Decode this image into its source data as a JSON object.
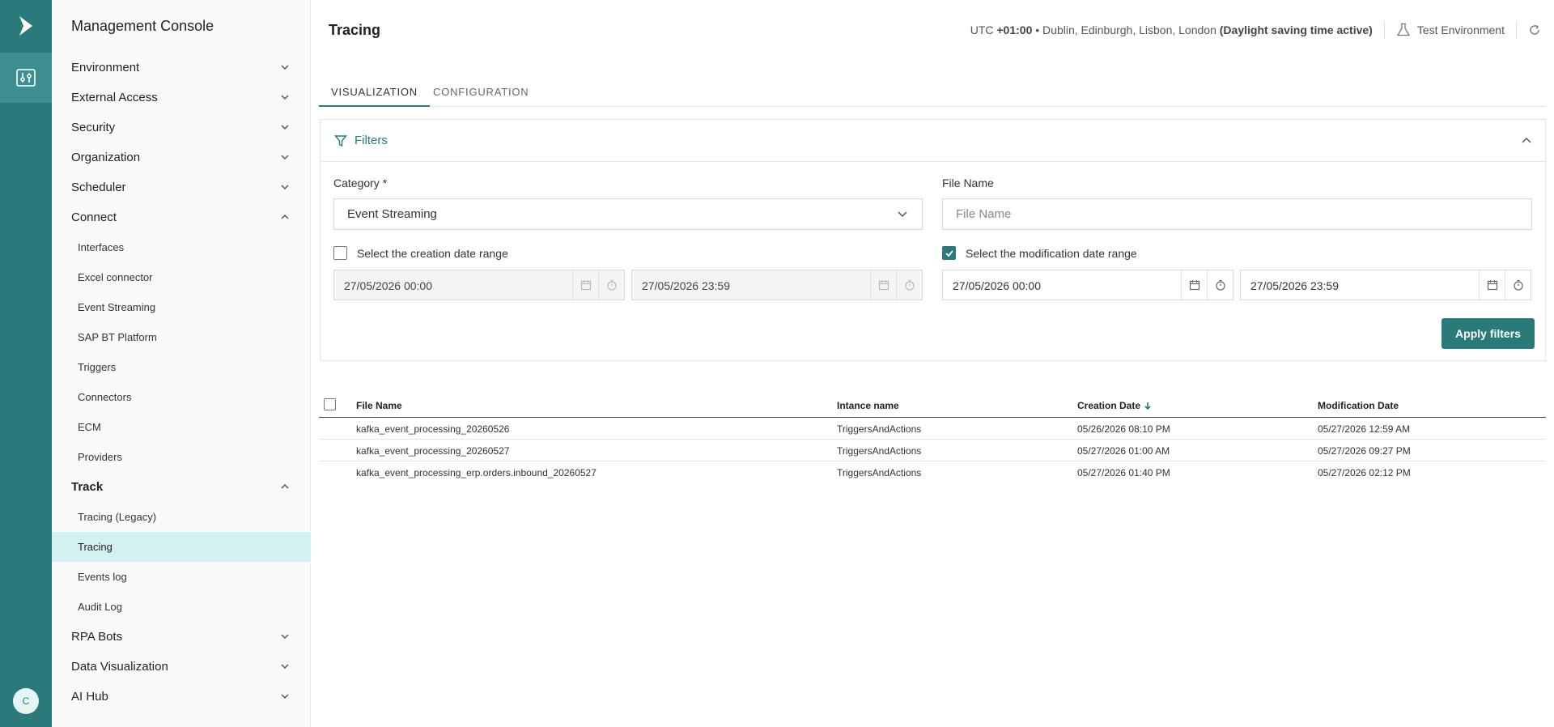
{
  "colors": {
    "primary": "#2a7a7a",
    "active_item_bg": "#d4f1f1"
  },
  "rail": {
    "logo_icon": "play-arrow-icon",
    "active_icon": "sliders-icon",
    "avatar_initial": "C"
  },
  "sidebar": {
    "title": "Management Console",
    "items": [
      {
        "label": "Environment",
        "expanded": false
      },
      {
        "label": "External Access",
        "expanded": false
      },
      {
        "label": "Security",
        "expanded": false
      },
      {
        "label": "Organization",
        "expanded": false
      },
      {
        "label": "Scheduler",
        "expanded": false
      },
      {
        "label": "Connect",
        "expanded": true,
        "children": [
          "Interfaces",
          "Excel connector",
          "Event Streaming",
          "SAP BT Platform",
          "Triggers",
          "Connectors",
          "ECM",
          "Providers"
        ]
      },
      {
        "label": "Track",
        "expanded": true,
        "children": [
          "Tracing (Legacy)",
          "Tracing",
          "Events log",
          "Audit Log"
        ],
        "active_child": "Tracing"
      },
      {
        "label": "RPA Bots",
        "expanded": false
      },
      {
        "label": "Data Visualization",
        "expanded": false
      },
      {
        "label": "AI Hub",
        "expanded": false
      }
    ]
  },
  "header": {
    "title": "Tracing",
    "timezone_prefix": "UTC",
    "timezone_offset": "+01:00",
    "timezone_cities": "• Dublin, Edinburgh, Lisbon, London",
    "timezone_dst": "(Daylight saving time active)",
    "environment": "Test Environment"
  },
  "tabs": [
    {
      "label": "VISUALIZATION",
      "active": true
    },
    {
      "label": "CONFIGURATION",
      "active": false
    }
  ],
  "filters": {
    "title": "Filters",
    "category_label": "Category *",
    "category_value": "Event Streaming",
    "file_name_label": "File Name",
    "file_name_placeholder": "File Name",
    "file_name_value": "",
    "creation_range_label": "Select the creation date range",
    "creation_range_checked": false,
    "creation_from": "27/05/2026 00:00",
    "creation_to": "27/05/2026 23:59",
    "modification_range_label": "Select the modification date range",
    "modification_range_checked": true,
    "modification_from": "27/05/2026 00:00",
    "modification_to": "27/05/2026 23:59",
    "apply_label": "Apply filters"
  },
  "table": {
    "columns": [
      "File Name",
      "Intance name",
      "Creation Date",
      "Modification Date"
    ],
    "sorted_column": "Creation Date",
    "sort_direction": "descending",
    "rows": [
      [
        "kafka_event_processing_20260526",
        "TriggersAndActions",
        "05/26/2026 08:10 PM",
        "05/27/2026 12:59 AM"
      ],
      [
        "kafka_event_processing_20260527",
        "TriggersAndActions",
        "05/27/2026 01:00 AM",
        "05/27/2026 09:27 PM"
      ],
      [
        "kafka_event_processing_erp.orders.inbound_20260527",
        "TriggersAndActions",
        "05/27/2026 01:40 PM",
        "05/27/2026 02:12 PM"
      ]
    ]
  }
}
